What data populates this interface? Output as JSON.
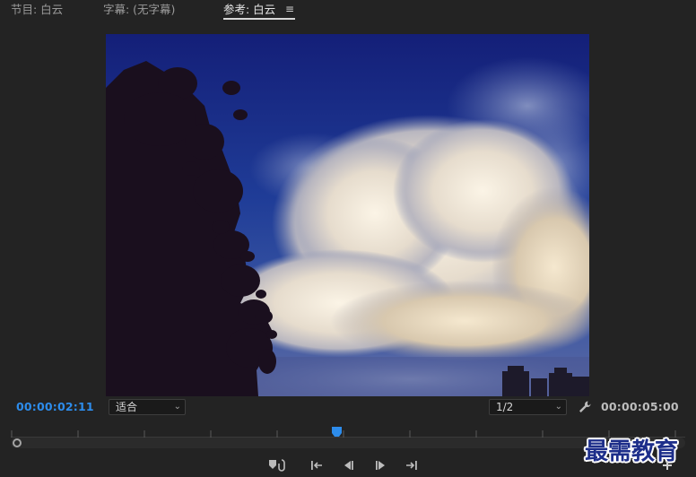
{
  "tabs": [
    {
      "label": "节目: 白云"
    },
    {
      "label": "字幕: (无字幕)"
    },
    {
      "label": "参考: 白云"
    }
  ],
  "tab_menu_icon": "hamburger-menu-icon",
  "viewer": {
    "subject": "sky-with-clouds-and-tree"
  },
  "controls": {
    "current_timecode": "00:00:02:11",
    "fit_select": "适合",
    "resolution_select": "1/2",
    "duration_timecode": "00:00:05:00"
  },
  "colors": {
    "accent": "#2d8ceb",
    "background": "#232323"
  },
  "icons": {
    "settings": "wrench-icon",
    "marker": "add-marker-icon",
    "prev_edit": "go-to-in-icon",
    "step_back": "step-back-icon",
    "step_forward": "step-forward-icon",
    "next_edit": "go-to-out-icon",
    "add": "plus-icon"
  },
  "watermark": "最需教育"
}
